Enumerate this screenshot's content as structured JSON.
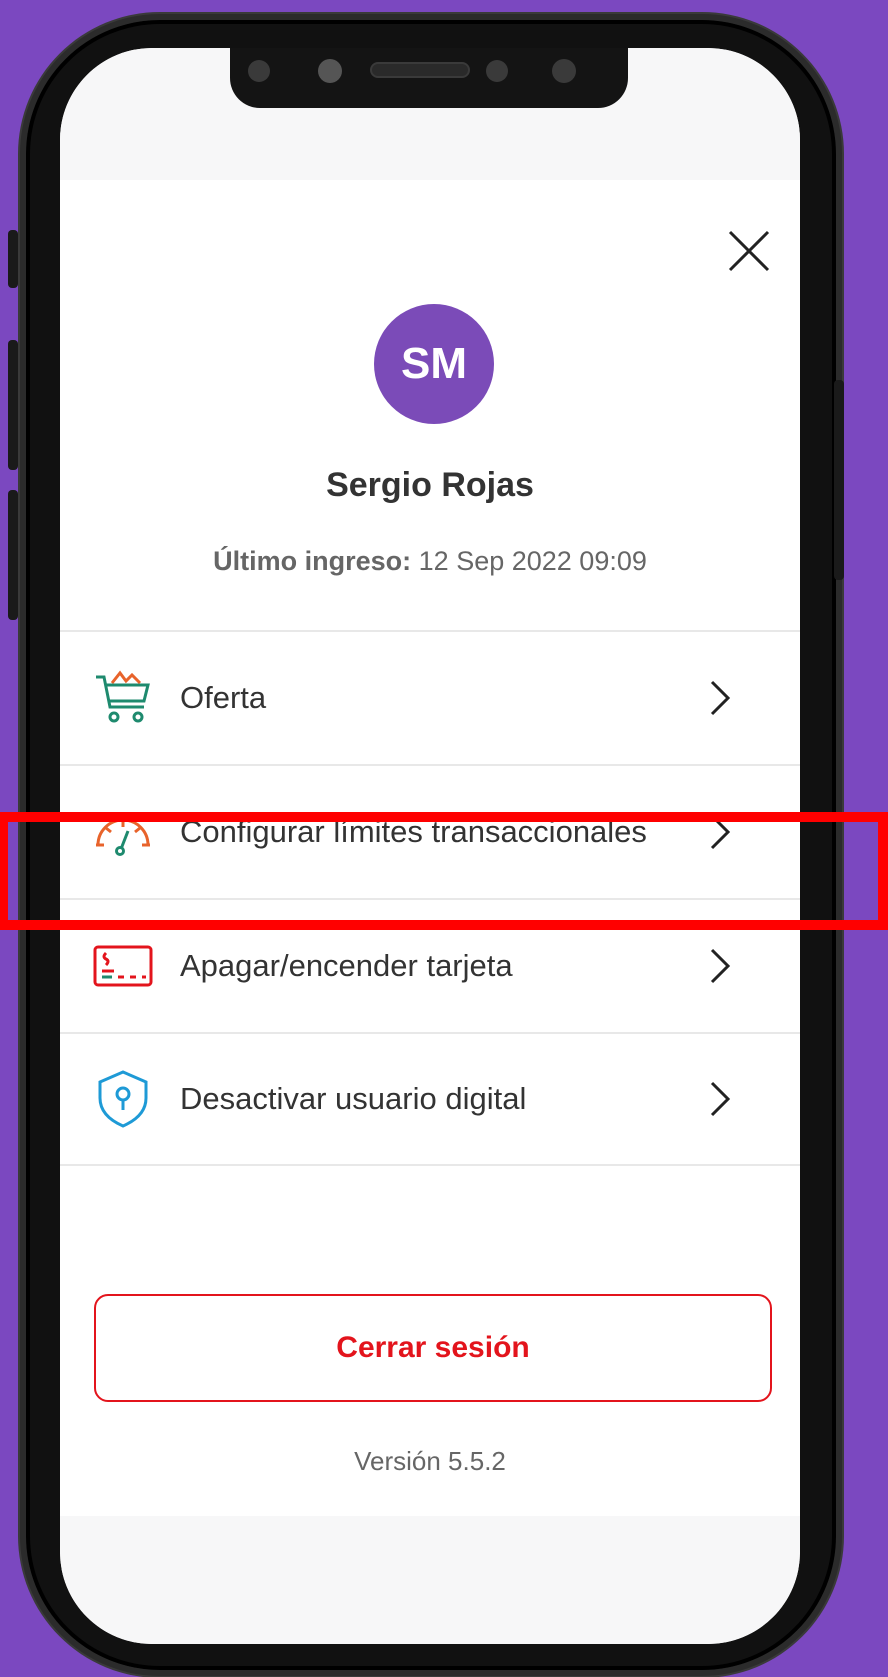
{
  "profile": {
    "initials": "SM",
    "name": "Sergio Rojas",
    "last_login_label": "Último ingreso:",
    "last_login_value": "12 Sep 2022 09:09"
  },
  "menu": {
    "items": [
      {
        "label": "Oferta",
        "icon": "shopping-cart-icon"
      },
      {
        "label": "Configurar límites transaccionales",
        "icon": "speedometer-icon"
      },
      {
        "label": "Apagar/encender tarjeta",
        "icon": "card-icon"
      },
      {
        "label": "Desactivar usuario digital",
        "icon": "shield-lock-icon"
      }
    ]
  },
  "logout_label": "Cerrar sesión",
  "version": "Versión 5.5.2",
  "colors": {
    "background": "#7b48c0",
    "avatar": "#7b4bb8",
    "brand_red": "#e3141c",
    "highlight": "#ff0000"
  }
}
